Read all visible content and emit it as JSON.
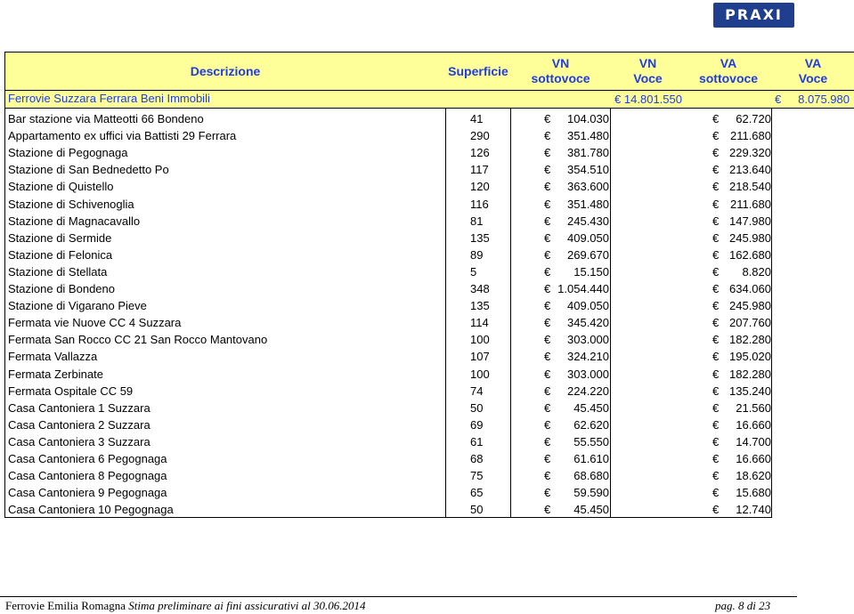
{
  "logo": {
    "text": "PRAXI"
  },
  "headers": {
    "descrizione": "Descrizione",
    "superficie": "Superficie",
    "vn_sottovoce": "VN\nsottovoce",
    "vn_voce": "VN\nVoce",
    "va_sottovoce": "VA\nsottovoce",
    "va_voce": "VA\nVoce"
  },
  "group": {
    "label": "Ferrovie Suzzara Ferrara Beni Immobili",
    "vn_voce": "14.801.550",
    "va_voce": "8.075.980"
  },
  "currency": "€",
  "rows": [
    {
      "desc": "Bar stazione via Matteotti 66 Bondeno",
      "sup": "41",
      "vn": "104.030",
      "va": "62.720"
    },
    {
      "desc": "Appartamento ex uffici via Battisti 29 Ferrara",
      "sup": "290",
      "vn": "351.480",
      "va": "211.680"
    },
    {
      "desc": "Stazione di Pegognaga",
      "sup": "126",
      "vn": "381.780",
      "va": "229.320"
    },
    {
      "desc": "Stazione di San Bednedetto Po",
      "sup": "117",
      "vn": "354.510",
      "va": "213.640"
    },
    {
      "desc": "Stazione di Quistello",
      "sup": "120",
      "vn": "363.600",
      "va": "218.540"
    },
    {
      "desc": "Stazione di Schivenoglia",
      "sup": "116",
      "vn": "351.480",
      "va": "211.680"
    },
    {
      "desc": "Stazione di Magnacavallo",
      "sup": "81",
      "vn": "245.430",
      "va": "147.980"
    },
    {
      "desc": "Stazione di Sermide",
      "sup": "135",
      "vn": "409.050",
      "va": "245.980"
    },
    {
      "desc": "Stazione di Felonica",
      "sup": "89",
      "vn": "269.670",
      "va": "162.680"
    },
    {
      "desc": "Stazione di Stellata",
      "sup": "5",
      "vn": "15.150",
      "va": "8.820"
    },
    {
      "desc": "Stazione di Bondeno",
      "sup": "348",
      "vn": "1.054.440",
      "va": "634.060"
    },
    {
      "desc": "Stazione di Vigarano Pieve",
      "sup": "135",
      "vn": "409.050",
      "va": "245.980"
    },
    {
      "desc": "Fermata vie Nuove CC 4 Suzzara",
      "sup": "114",
      "vn": "345.420",
      "va": "207.760"
    },
    {
      "desc": "Fermata San Rocco CC 21 San Rocco Mantovano",
      "sup": "100",
      "vn": "303.000",
      "va": "182.280"
    },
    {
      "desc": "Fermata Vallazza",
      "sup": "107",
      "vn": "324.210",
      "va": "195.020"
    },
    {
      "desc": "Fermata Zerbinate",
      "sup": "100",
      "vn": "303.000",
      "va": "182.280"
    },
    {
      "desc": "Fermata Ospitale CC 59",
      "sup": "74",
      "vn": "224.220",
      "va": "135.240"
    },
    {
      "desc": "Casa Cantoniera 1 Suzzara",
      "sup": "50",
      "vn": "45.450",
      "va": "21.560"
    },
    {
      "desc": "Casa Cantoniera 2 Suzzara",
      "sup": "69",
      "vn": "62.620",
      "va": "16.660"
    },
    {
      "desc": "Casa Cantoniera 3 Suzzara",
      "sup": "61",
      "vn": "55.550",
      "va": "14.700"
    },
    {
      "desc": "Casa Cantoniera 6 Pegognaga",
      "sup": "68",
      "vn": "61.610",
      "va": "16.660"
    },
    {
      "desc": "Casa Cantoniera 8 Pegognaga",
      "sup": "75",
      "vn": "68.680",
      "va": "18.620"
    },
    {
      "desc": "Casa Cantoniera 9 Pegognaga",
      "sup": "65",
      "vn": "59.590",
      "va": "15.680"
    },
    {
      "desc": "Casa Cantoniera 10 Pegognaga",
      "sup": "50",
      "vn": "45.450",
      "va": "12.740"
    }
  ],
  "footer": {
    "org": "Ferrovie Emilia Romagna",
    "subtitle": "Stima preliminare ai fini assicurativi  al 30.06.2014",
    "page": "pag. 8 di 23"
  },
  "colors": {
    "header_bg": "#ffff99",
    "header_text": "#1f3de0",
    "logo_bg": "#1f3e8e"
  }
}
